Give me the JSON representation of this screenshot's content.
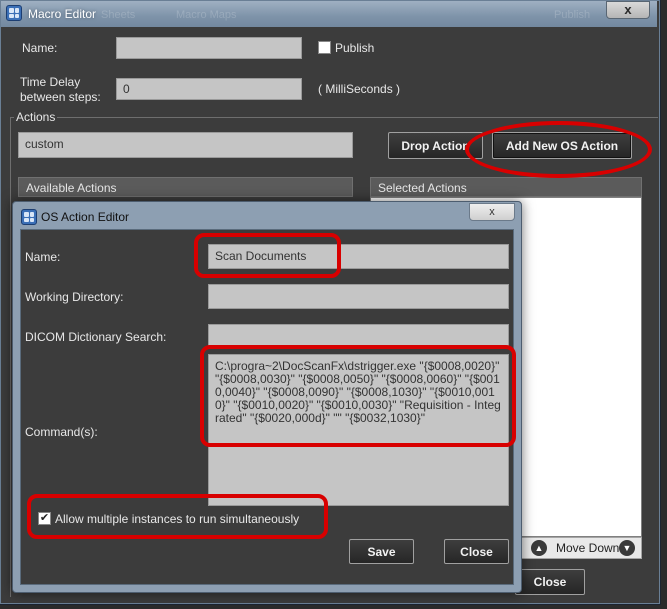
{
  "macro_editor": {
    "title": "Macro Editor",
    "title_ghost": [
      "Sheets",
      "Macro Maps",
      "Publish"
    ],
    "close_glyph": "x",
    "name_label": "Name:",
    "name_value": "",
    "publish_label": "Publish",
    "publish_checked": false,
    "time_delay_label_line1": "Time Delay",
    "time_delay_label_line2": "between steps:",
    "time_delay_value": "0",
    "time_delay_unit": "( MilliSeconds )",
    "actions_label": "Actions",
    "action_type_value": "custom",
    "drop_action_label": "Drop Action",
    "add_os_action_label": "Add New OS Action",
    "available_actions_header": "Available Actions",
    "selected_actions_header": "Selected Actions",
    "move_down_label": "Move Down",
    "close_label": "Close"
  },
  "os_action_editor": {
    "title": "OS Action Editor",
    "close_glyph": "x",
    "name_label": "Name:",
    "name_value": "Scan Documents",
    "working_dir_label": "Working Directory:",
    "working_dir_value": "",
    "dicom_search_label": "DICOM Dictionary Search:",
    "dicom_search_value": "",
    "commands_label": "Command(s):",
    "commands_value": "C:\\progra~2\\DocScanFx\\dstrigger.exe \"{$0008,0020}\" \"{$0008,0030}\" \"{$0008,0050}\" \"{$0008,0060}\" \"{$0010,0040}\" \"{$0008,0090}\" \"{$0008,1030}\" \"{$0010,0010}\" \"{$0010,0020}\" \"{$0010,0030}\" \"Requisition - Integrated\" \"{$0020,000d}\" \"\" \"{$0032,1030}\"",
    "allow_multiple_label": "Allow multiple instances to  run simultaneously",
    "allow_multiple_checked": true,
    "save_label": "Save",
    "close_label": "Close"
  },
  "colors": {
    "highlight": "#d80000",
    "window_bg": "#3c3c3c",
    "field_bg": "#c5c5c5"
  },
  "icons": {
    "app": "app-grid-icon",
    "move_up": "chevron-up-circle-icon",
    "move_down": "chevron-down-circle-icon"
  }
}
